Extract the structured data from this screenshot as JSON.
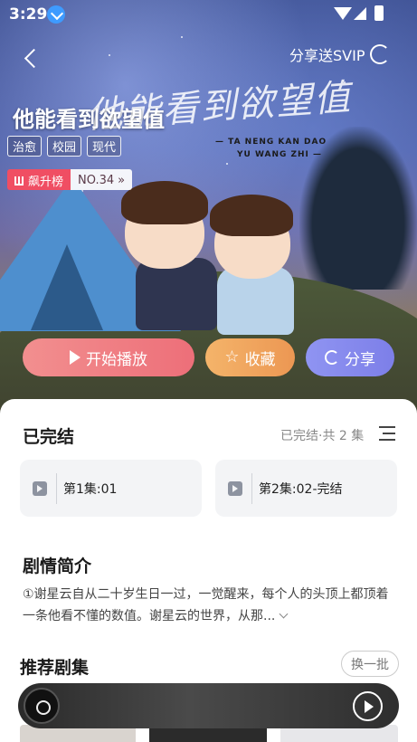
{
  "status_bar": {
    "time": "3:29"
  },
  "header": {
    "share_label": "分享送SVIP"
  },
  "show": {
    "title": "他能看到欲望值",
    "handwritten_subtitle": [
      "— TA NENG KAN DAO",
      "YU WANG ZHI —"
    ],
    "tags": [
      "治愈",
      "校园",
      "现代"
    ],
    "rank": {
      "name": "飙升榜",
      "number": "NO.34"
    }
  },
  "actions": {
    "play": "开始播放",
    "favorite": "收藏",
    "share": "分享"
  },
  "episodes": {
    "title": "已完结",
    "summary": "已完结·共 2 集",
    "items": [
      "第1集:01",
      "第2集:02-完结"
    ]
  },
  "synopsis": {
    "title": "剧情简介",
    "text": "①谢星云自从二十岁生日一过，一觉醒来，每个人的头顶上都顶着一条他看不懂的数值。谢星云的世界，从那..."
  },
  "recommend": {
    "title": "推荐剧集",
    "swap_label": "换一批"
  },
  "colors": {
    "play": "#ed6f79",
    "favorite": "#ec9753",
    "share": "#7d7fe8",
    "rank": "#f04e63"
  }
}
